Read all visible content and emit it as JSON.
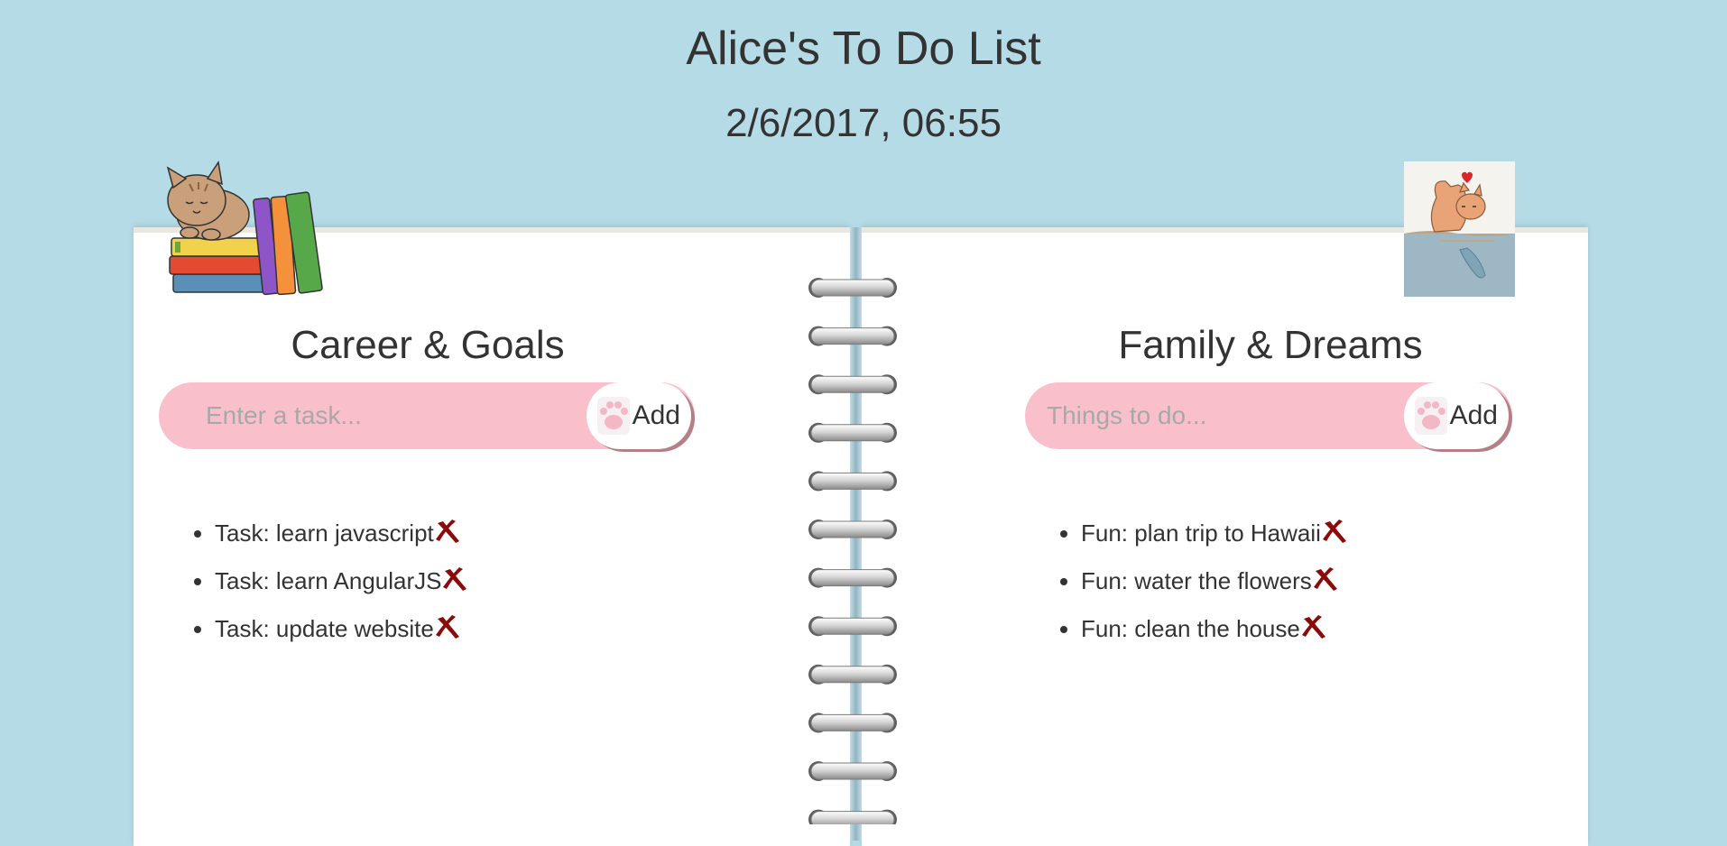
{
  "header": {
    "title": "Alice's To Do List",
    "datetime": "2/6/2017, 06:55"
  },
  "left_page": {
    "heading": "Career & Goals",
    "input_placeholder": "Enter a task...",
    "add_label": "Add",
    "tasks": [
      "Task: learn javascript",
      "Task: learn AngularJS",
      "Task: update website"
    ]
  },
  "right_page": {
    "heading": "Family & Dreams",
    "input_placeholder": "Things to do...",
    "add_label": "Add",
    "tasks": [
      "Fun: plan trip to Hawaii",
      "Fun: water the flowers",
      "Fun: clean the house"
    ]
  },
  "colors": {
    "background": "#b5dce6",
    "input_pink": "#f9c0cc",
    "delete_icon": "#8b0a0a"
  },
  "icons": {
    "delete": "x-mark-icon",
    "add": "paw-icon",
    "left_decoration": "cat-on-books-illustration",
    "right_decoration": "cat-and-fish-illustration"
  }
}
